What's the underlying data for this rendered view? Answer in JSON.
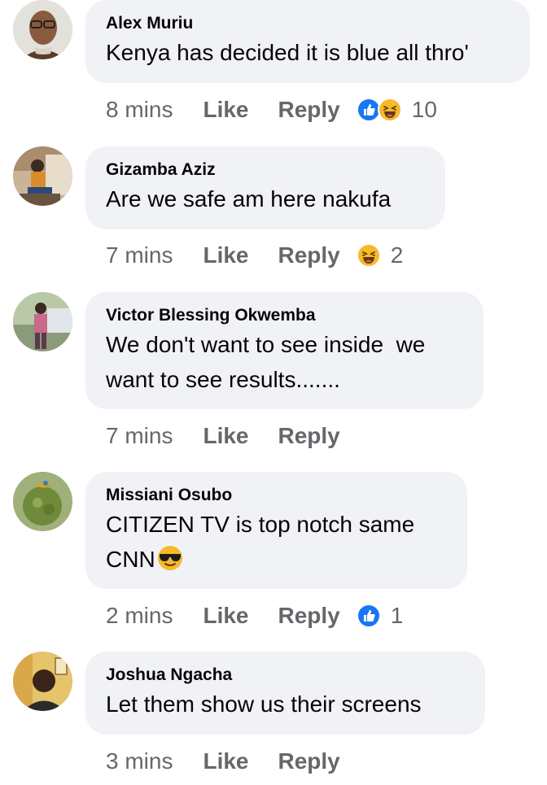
{
  "comments": [
    {
      "author": "Alex Muriu",
      "text": "Kenya has decided it is blue all thro'",
      "time": "8 mins",
      "like_label": "Like",
      "reply_label": "Reply",
      "reactions": [
        "like-icon",
        "haha-icon"
      ],
      "reaction_count": "10"
    },
    {
      "author": "Gizamba Aziz",
      "text": "Are we safe am here nakufa",
      "time": "7 mins",
      "like_label": "Like",
      "reply_label": "Reply",
      "reactions": [
        "haha-icon"
      ],
      "reaction_count": "2"
    },
    {
      "author": "Victor Blessing Okwemba",
      "text_line1": "We don't want to see inside  we",
      "text_line2": "want to see results.......",
      "time": "7 mins",
      "like_label": "Like",
      "reply_label": "Reply"
    },
    {
      "author": "Missiani Osubo",
      "text_line1": "CITIZEN TV is top notch same",
      "text_line2": "CNN",
      "inline_emoji": "sunglasses-emoji",
      "time": "2 mins",
      "like_label": "Like",
      "reply_label": "Reply",
      "reactions": [
        "like-icon"
      ],
      "reaction_count": "1"
    },
    {
      "author": "Joshua Ngacha",
      "text": "Let them show us their screens",
      "time": "3 mins",
      "like_label": "Like",
      "reply_label": "Reply"
    }
  ],
  "colors": {
    "bubble": "#f0f2f5",
    "meta_text": "#65676b",
    "like_blue": "#1877f2",
    "haha_yellow": "#f7b928"
  }
}
